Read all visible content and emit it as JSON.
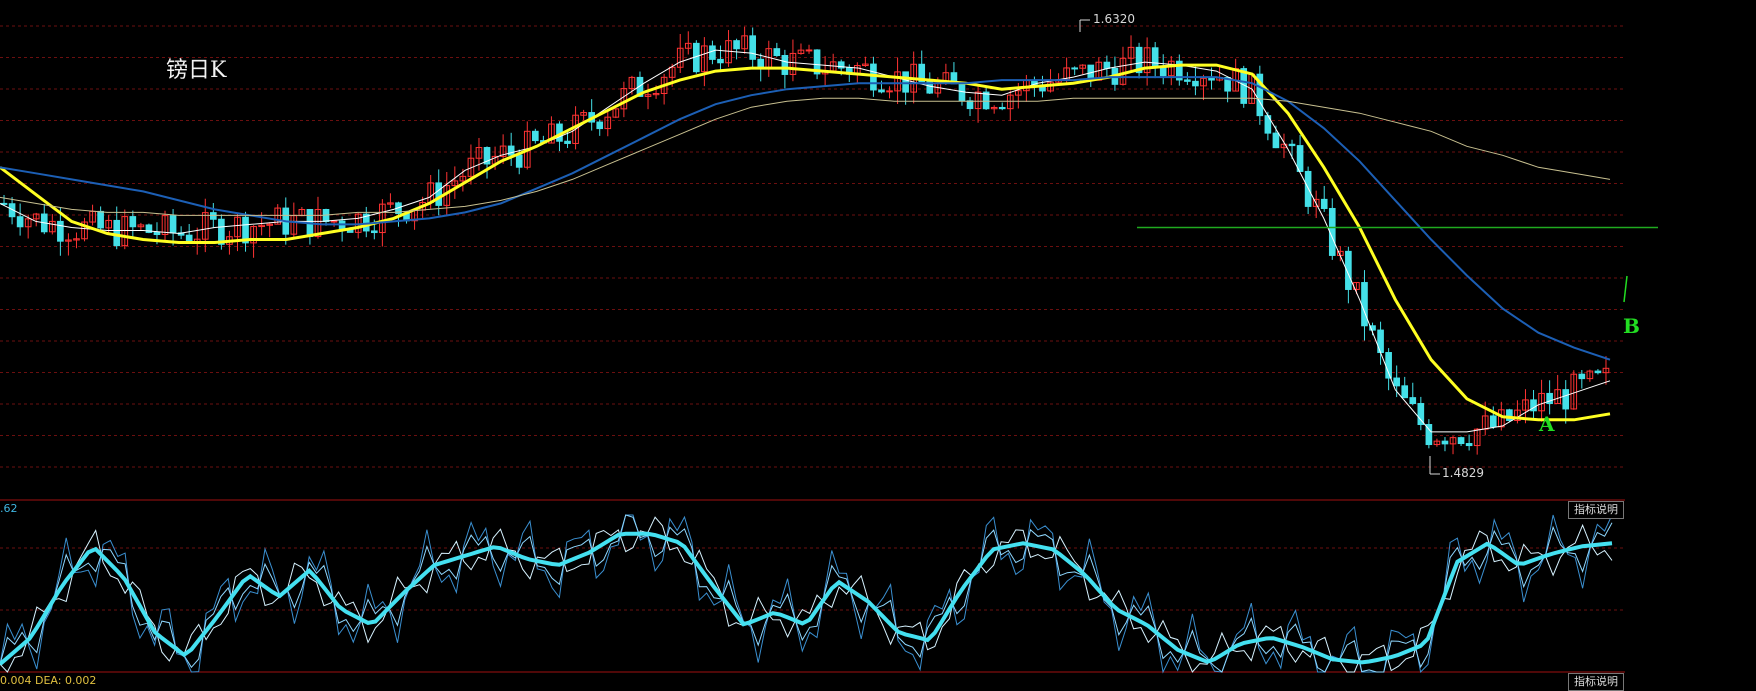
{
  "chart_data": [
    {
      "type": "candlestick",
      "title": "镑日K",
      "high_marker": "1.6320",
      "low_marker": "1.4829",
      "annotations": [
        "A",
        "B"
      ],
      "series": [
        {
          "values": [
            1.572,
            1.566,
            1.564,
            1.563,
            1.563,
            1.562,
            1.564,
            1.565,
            1.566,
            1.566,
            1.567,
            1.57,
            1.574,
            1.583,
            1.588,
            1.591,
            1.596,
            1.604,
            1.612,
            1.619,
            1.623,
            1.622,
            1.619,
            1.618,
            1.617,
            1.614,
            1.611,
            1.609,
            1.608,
            1.612,
            1.614,
            1.617,
            1.619,
            1.618,
            1.616,
            1.61,
            1.59,
            1.567,
            1.54,
            1.51,
            1.496,
            1.496,
            1.498,
            1.505,
            1.509,
            1.513
          ]
        },
        {
          "values": [
            1.584,
            1.575,
            1.566,
            1.562,
            1.56,
            1.559,
            1.559,
            1.56,
            1.56,
            1.562,
            1.564,
            1.567,
            1.572,
            1.579,
            1.586,
            1.591,
            1.597,
            1.603,
            1.609,
            1.613,
            1.616,
            1.617,
            1.617,
            1.616,
            1.615,
            1.614,
            1.613,
            1.612,
            1.61,
            1.611,
            1.612,
            1.614,
            1.617,
            1.618,
            1.618,
            1.615,
            1.602,
            1.584,
            1.564,
            1.54,
            1.52,
            1.507,
            1.501,
            1.5,
            1.5,
            1.502
          ]
        },
        {
          "values": [
            1.584,
            1.582,
            1.58,
            1.578,
            1.576,
            1.573,
            1.57,
            1.568,
            1.566,
            1.565,
            1.565,
            1.566,
            1.567,
            1.569,
            1.572,
            1.577,
            1.582,
            1.588,
            1.594,
            1.6,
            1.605,
            1.608,
            1.61,
            1.611,
            1.612,
            1.612,
            1.612,
            1.612,
            1.613,
            1.613,
            1.613,
            1.614,
            1.614,
            1.614,
            1.614,
            1.612,
            1.606,
            1.597,
            1.586,
            1.573,
            1.56,
            1.548,
            1.537,
            1.529,
            1.524,
            1.52
          ]
        },
        {
          "values": [
            1.574,
            1.572,
            1.57,
            1.569,
            1.569,
            1.568,
            1.568,
            1.568,
            1.568,
            1.568,
            1.569,
            1.569,
            1.57,
            1.571,
            1.573,
            1.576,
            1.58,
            1.585,
            1.59,
            1.595,
            1.6,
            1.604,
            1.606,
            1.607,
            1.607,
            1.606,
            1.606,
            1.606,
            1.606,
            1.606,
            1.607,
            1.607,
            1.607,
            1.607,
            1.607,
            1.607,
            1.606,
            1.604,
            1.602,
            1.599,
            1.596,
            1.591,
            1.588,
            1.584,
            1.582,
            1.58
          ]
        }
      ],
      "ylim": [
        1.475,
        1.637
      ],
      "reference_line": 1.564,
      "grid": true
    },
    {
      "type": "line",
      "indicator_value": ".62",
      "button": "指标说明",
      "series": [
        {
          "values": [
            5,
            22,
            55,
            80,
            60,
            25,
            10,
            35,
            62,
            48,
            65,
            40,
            30,
            50,
            68,
            74,
            80,
            72,
            68,
            76,
            88,
            88,
            82,
            55,
            30,
            38,
            30,
            58,
            45,
            25,
            20,
            52,
            78,
            82,
            78,
            62,
            40,
            30,
            14,
            6,
            18,
            22,
            16,
            8,
            6,
            10,
            18,
            70,
            82,
            68,
            75,
            80,
            82
          ]
        }
      ],
      "ylim": [
        0,
        100
      ],
      "grid": true
    }
  ],
  "bottom_bar": {
    "values_text": "0.004 DEA: 0.002",
    "button": "指标说明"
  }
}
